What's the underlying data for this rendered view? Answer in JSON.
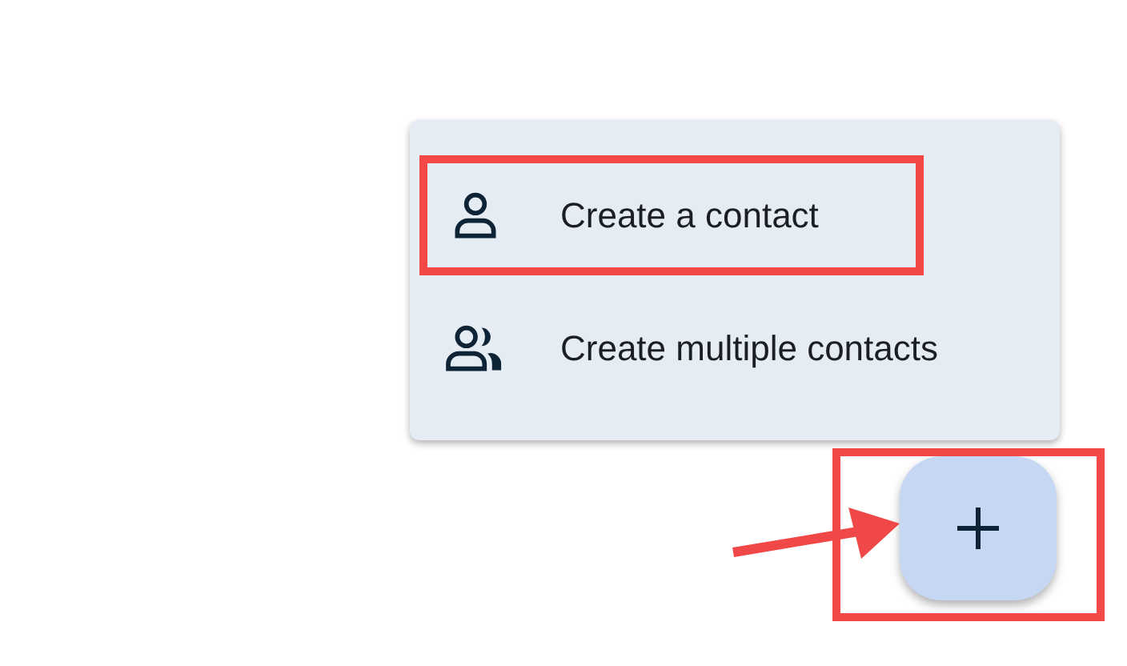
{
  "menu": {
    "items": [
      {
        "kind": "single",
        "label": "Create a contact",
        "highlighted": true
      },
      {
        "kind": "multiple",
        "label": "Create multiple contacts",
        "highlighted": false
      }
    ]
  },
  "fab": {
    "highlighted": true,
    "arrow": true
  }
}
